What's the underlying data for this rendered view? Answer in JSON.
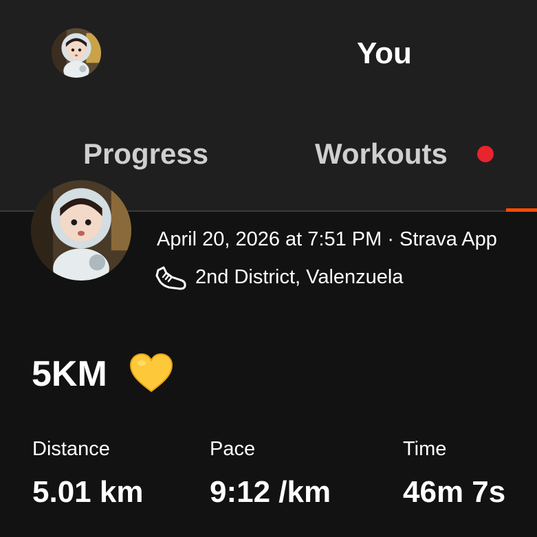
{
  "header": {
    "title": "You",
    "avatar_icon": "user-avatar"
  },
  "tabs": [
    {
      "label": "Progress",
      "selected": false
    },
    {
      "label": "Workouts",
      "selected": true,
      "has_notification_dot": true
    }
  ],
  "colors": {
    "accent": "#fc4c02",
    "notification": "#e8242d",
    "header_bg": "#1f1f1f",
    "body_bg": "#121212"
  },
  "activity": {
    "datetime_source": "April 20, 2026 at 7:51 PM · Strava App",
    "sport_icon": "running-shoe-icon",
    "location": "2nd District, Valenzuela",
    "title": "5KM",
    "title_emoji": "yellow-heart-icon",
    "stats": [
      {
        "label": "Distance",
        "value": "5.01 km"
      },
      {
        "label": "Pace",
        "value": "9:12 /km"
      },
      {
        "label": "Time",
        "value": "46m 7s"
      }
    ]
  }
}
